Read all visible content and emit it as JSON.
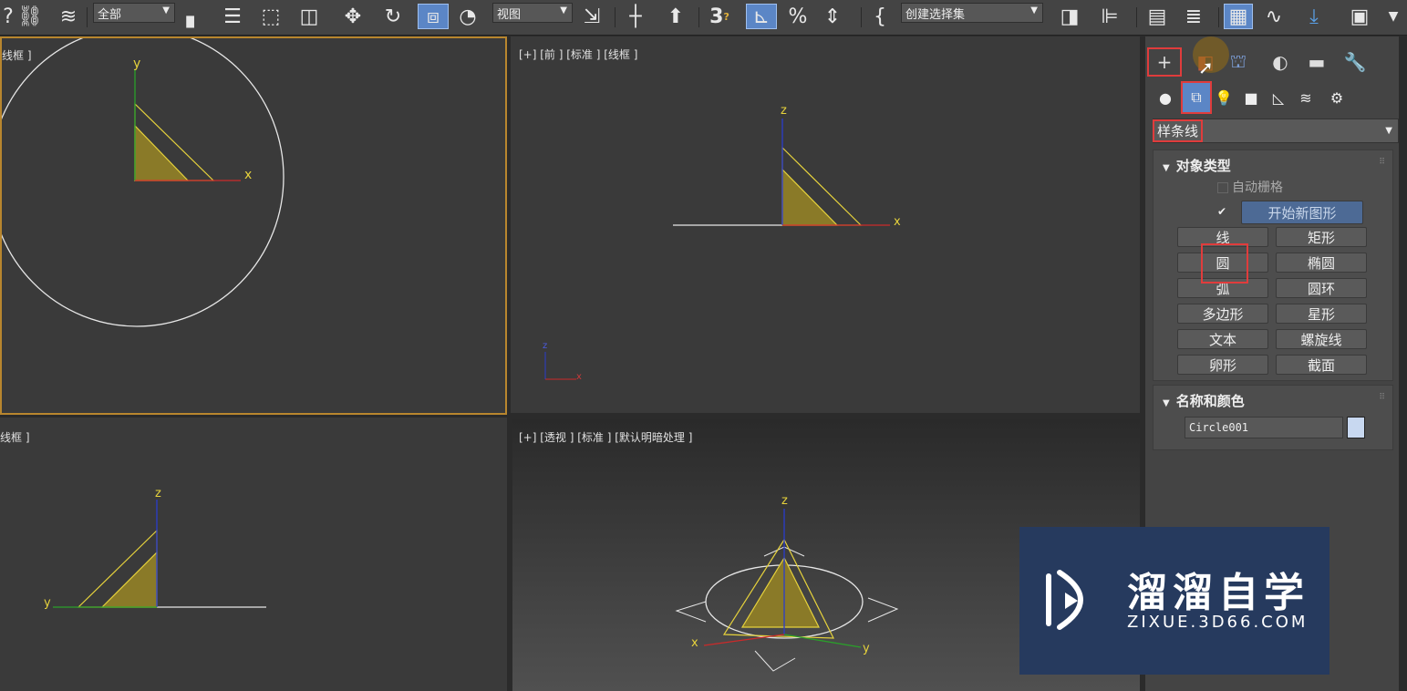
{
  "toolbar": {
    "filter_dropdown": "全部",
    "refcoord_dropdown": "视图",
    "selection_set_dropdown": "创建选择集",
    "snap_label": "3",
    "snap_sup": "?",
    "percent_label": "%",
    "curly_label": "{"
  },
  "viewports": {
    "top": {
      "label": "线框 ]"
    },
    "front": {
      "label": "[+] [前 ] [标准 ] [线框 ]"
    },
    "left": {
      "label": "线框 ]"
    },
    "perspective": {
      "label": "[+] [透视 ] [标准 ] [默认明暗处理 ]"
    }
  },
  "axes": {
    "x": "x",
    "y": "y",
    "z": "z"
  },
  "command_panel": {
    "category_dropdown": "样条线",
    "object_type": {
      "title": "对象类型",
      "auto_grid": "自动栅格",
      "start_new_shape": "开始新图形",
      "buttons": [
        "线",
        "矩形",
        "圆",
        "椭圆",
        "弧",
        "圆环",
        "多边形",
        "星形",
        "文本",
        "螺旋线",
        "卵形",
        "截面"
      ]
    },
    "name_color": {
      "title": "名称和颜色",
      "name_value": "Circle001",
      "color": "#c8d8f0"
    }
  },
  "watermark": {
    "brand": "溜溜自学",
    "url": "ZIXUE.3D66.COM"
  },
  "colors": {
    "selection_yellow": "#e6d23c",
    "axis_x": "#cc2a2a",
    "axis_y": "#2aa02a",
    "axis_z": "#2a3ccc",
    "highlight_red": "#e03c3c",
    "active_viewport_border": "#b8862e"
  }
}
